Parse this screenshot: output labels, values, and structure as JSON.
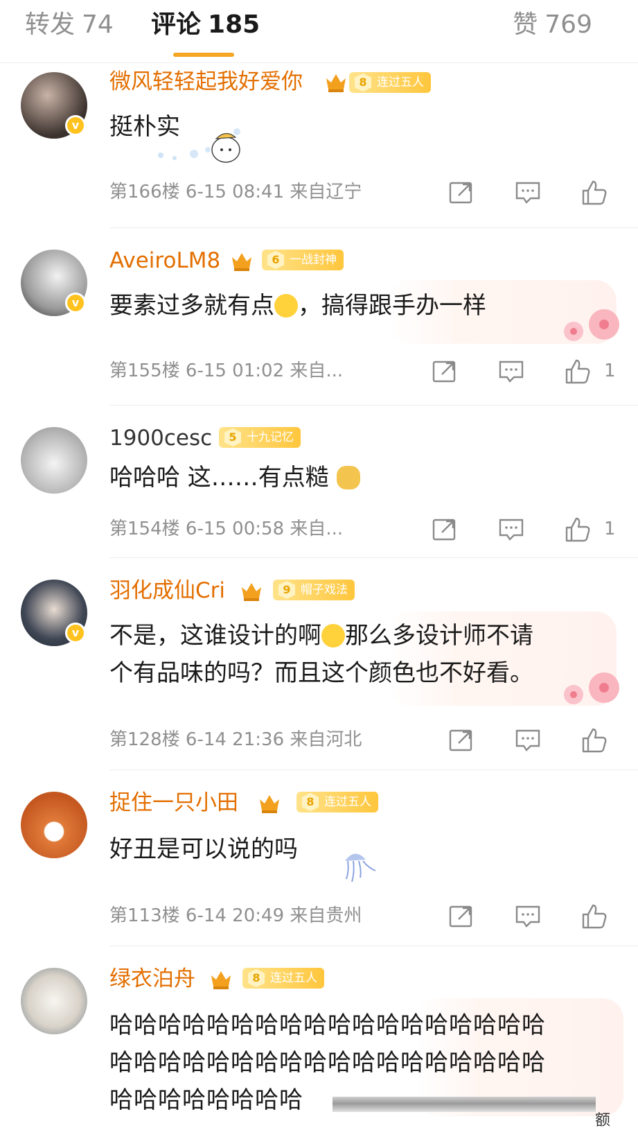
{
  "tabs": {
    "repost": {
      "label": "转发",
      "count": "74"
    },
    "comment": {
      "label": "评论",
      "count": "185"
    },
    "like": {
      "label": "赞",
      "count": "769"
    }
  },
  "comments": [
    {
      "user": "微风轻轻起我好爱你",
      "badge_level": "8",
      "badge_text": "连过五人",
      "text": "挺朴实",
      "floor": "第166楼",
      "time": "6-15 08:41",
      "location": "来自辽宁",
      "likes": ""
    },
    {
      "user": "AveiroLM8",
      "badge_level": "6",
      "badge_text": "一战封神",
      "text_a": "要素过多就有点",
      "text_b": "，搞得跟手办一样",
      "floor": "第155楼",
      "time": "6-15 01:02",
      "location": "来自...",
      "likes": "1"
    },
    {
      "user": "1900cesc",
      "badge_level": "5",
      "badge_text": "十九记忆",
      "text": "哈哈哈 这……有点糙",
      "floor": "第154楼",
      "time": "6-15 00:58",
      "location": "来自...",
      "likes": "1"
    },
    {
      "user": "羽化成仙Cri",
      "badge_level": "9",
      "badge_text": "帽子戏法",
      "text_a": "不是，这谁设计的啊",
      "text_b": "那么多设计师不请",
      "text_c": "个有品味的吗？而且这个颜色也不好看。",
      "floor": "第128楼",
      "time": "6-14 21:36",
      "location": "来自河北",
      "likes": ""
    },
    {
      "user": "捉住一只小田",
      "badge_level": "8",
      "badge_text": "连过五人",
      "text": "好丑是可以说的吗",
      "floor": "第113楼",
      "time": "6-14 20:49",
      "location": "来自贵州",
      "likes": ""
    },
    {
      "user": "绿衣泊舟",
      "badge_level": "8",
      "badge_text": "连过五人",
      "line1": "哈哈哈哈哈哈哈哈哈哈哈哈哈哈哈哈哈哈",
      "line2": "哈哈哈哈哈哈哈哈哈哈哈哈哈哈哈哈哈哈",
      "line3": "哈哈哈哈哈哈哈哈"
    }
  ],
  "corner_mark": "额",
  "colors": {
    "accent": "#f5a623",
    "vip_name": "#e36e00",
    "meta": "#8f8f8f",
    "badge": "#ffc63d"
  },
  "icons": [
    "repost-icon",
    "comment-icon",
    "like-icon",
    "verified-icon",
    "crown-icon"
  ]
}
